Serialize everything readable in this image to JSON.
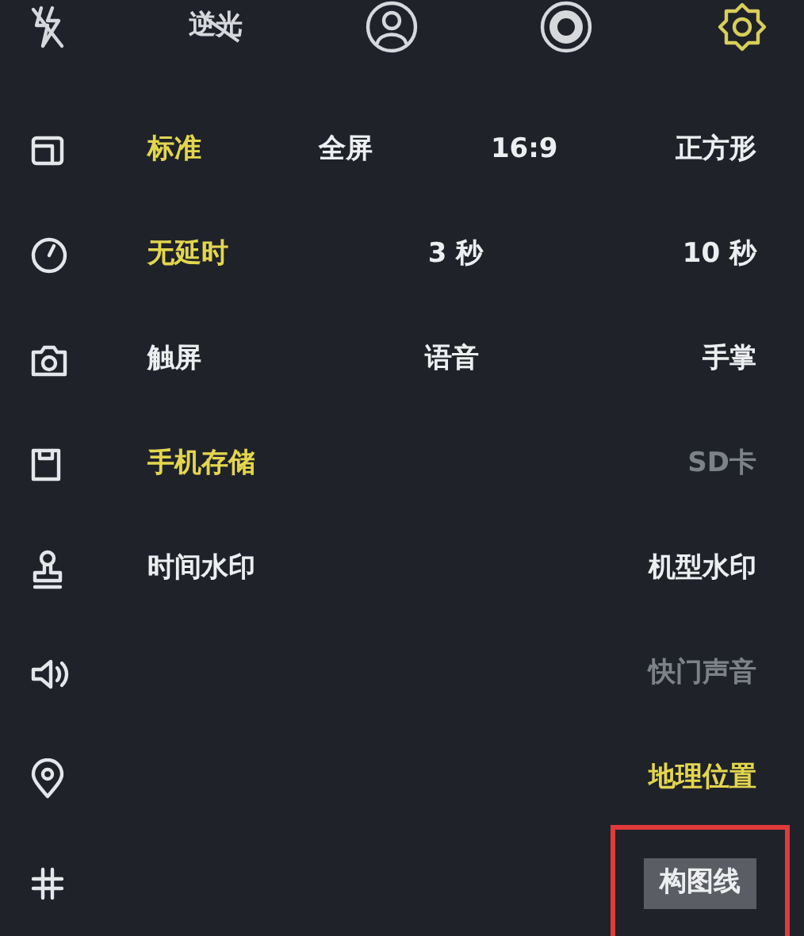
{
  "top_bar": [
    {
      "kind": "flash-off",
      "selected": false
    },
    {
      "kind": "text-off",
      "label": "逆光",
      "selected": false
    },
    {
      "kind": "portrait",
      "selected": false
    },
    {
      "kind": "ring",
      "selected": false
    },
    {
      "kind": "settings",
      "selected": true
    }
  ],
  "rows": [
    {
      "kind": "aspect",
      "options": [
        {
          "label": "标准",
          "selected": true,
          "disabled": false
        },
        {
          "label": "全屏",
          "selected": false,
          "disabled": false
        },
        {
          "label": "16:9",
          "selected": false,
          "disabled": false
        },
        {
          "label": "正方形",
          "selected": false,
          "disabled": false
        }
      ]
    },
    {
      "kind": "timer",
      "options": [
        {
          "label": "无延时",
          "selected": true,
          "disabled": false
        },
        {
          "label": "3 秒",
          "selected": false,
          "disabled": false
        },
        {
          "label": "10 秒",
          "selected": false,
          "disabled": false
        }
      ]
    },
    {
      "kind": "camera",
      "options": [
        {
          "label": "触屏",
          "selected": false,
          "disabled": false
        },
        {
          "label": "语音",
          "selected": false,
          "disabled": false
        },
        {
          "label": "手掌",
          "selected": false,
          "disabled": false
        }
      ]
    },
    {
      "kind": "storage",
      "options": [
        {
          "label": "手机存储",
          "selected": true,
          "disabled": false
        },
        {
          "label": "SD卡",
          "selected": false,
          "disabled": true
        }
      ]
    },
    {
      "kind": "stamp",
      "options": [
        {
          "label": "时间水印",
          "selected": false,
          "disabled": false
        },
        {
          "label": "机型水印",
          "selected": false,
          "disabled": false
        }
      ]
    },
    {
      "kind": "speaker",
      "options": [
        {
          "label": "快门声音",
          "selected": false,
          "disabled": true
        }
      ]
    },
    {
      "kind": "location",
      "options": [
        {
          "label": "地理位置",
          "selected": true,
          "disabled": false
        }
      ]
    },
    {
      "kind": "grid",
      "options": [
        {
          "label": "构图线",
          "selected": false,
          "disabled": false,
          "highlighted": true
        }
      ]
    }
  ]
}
